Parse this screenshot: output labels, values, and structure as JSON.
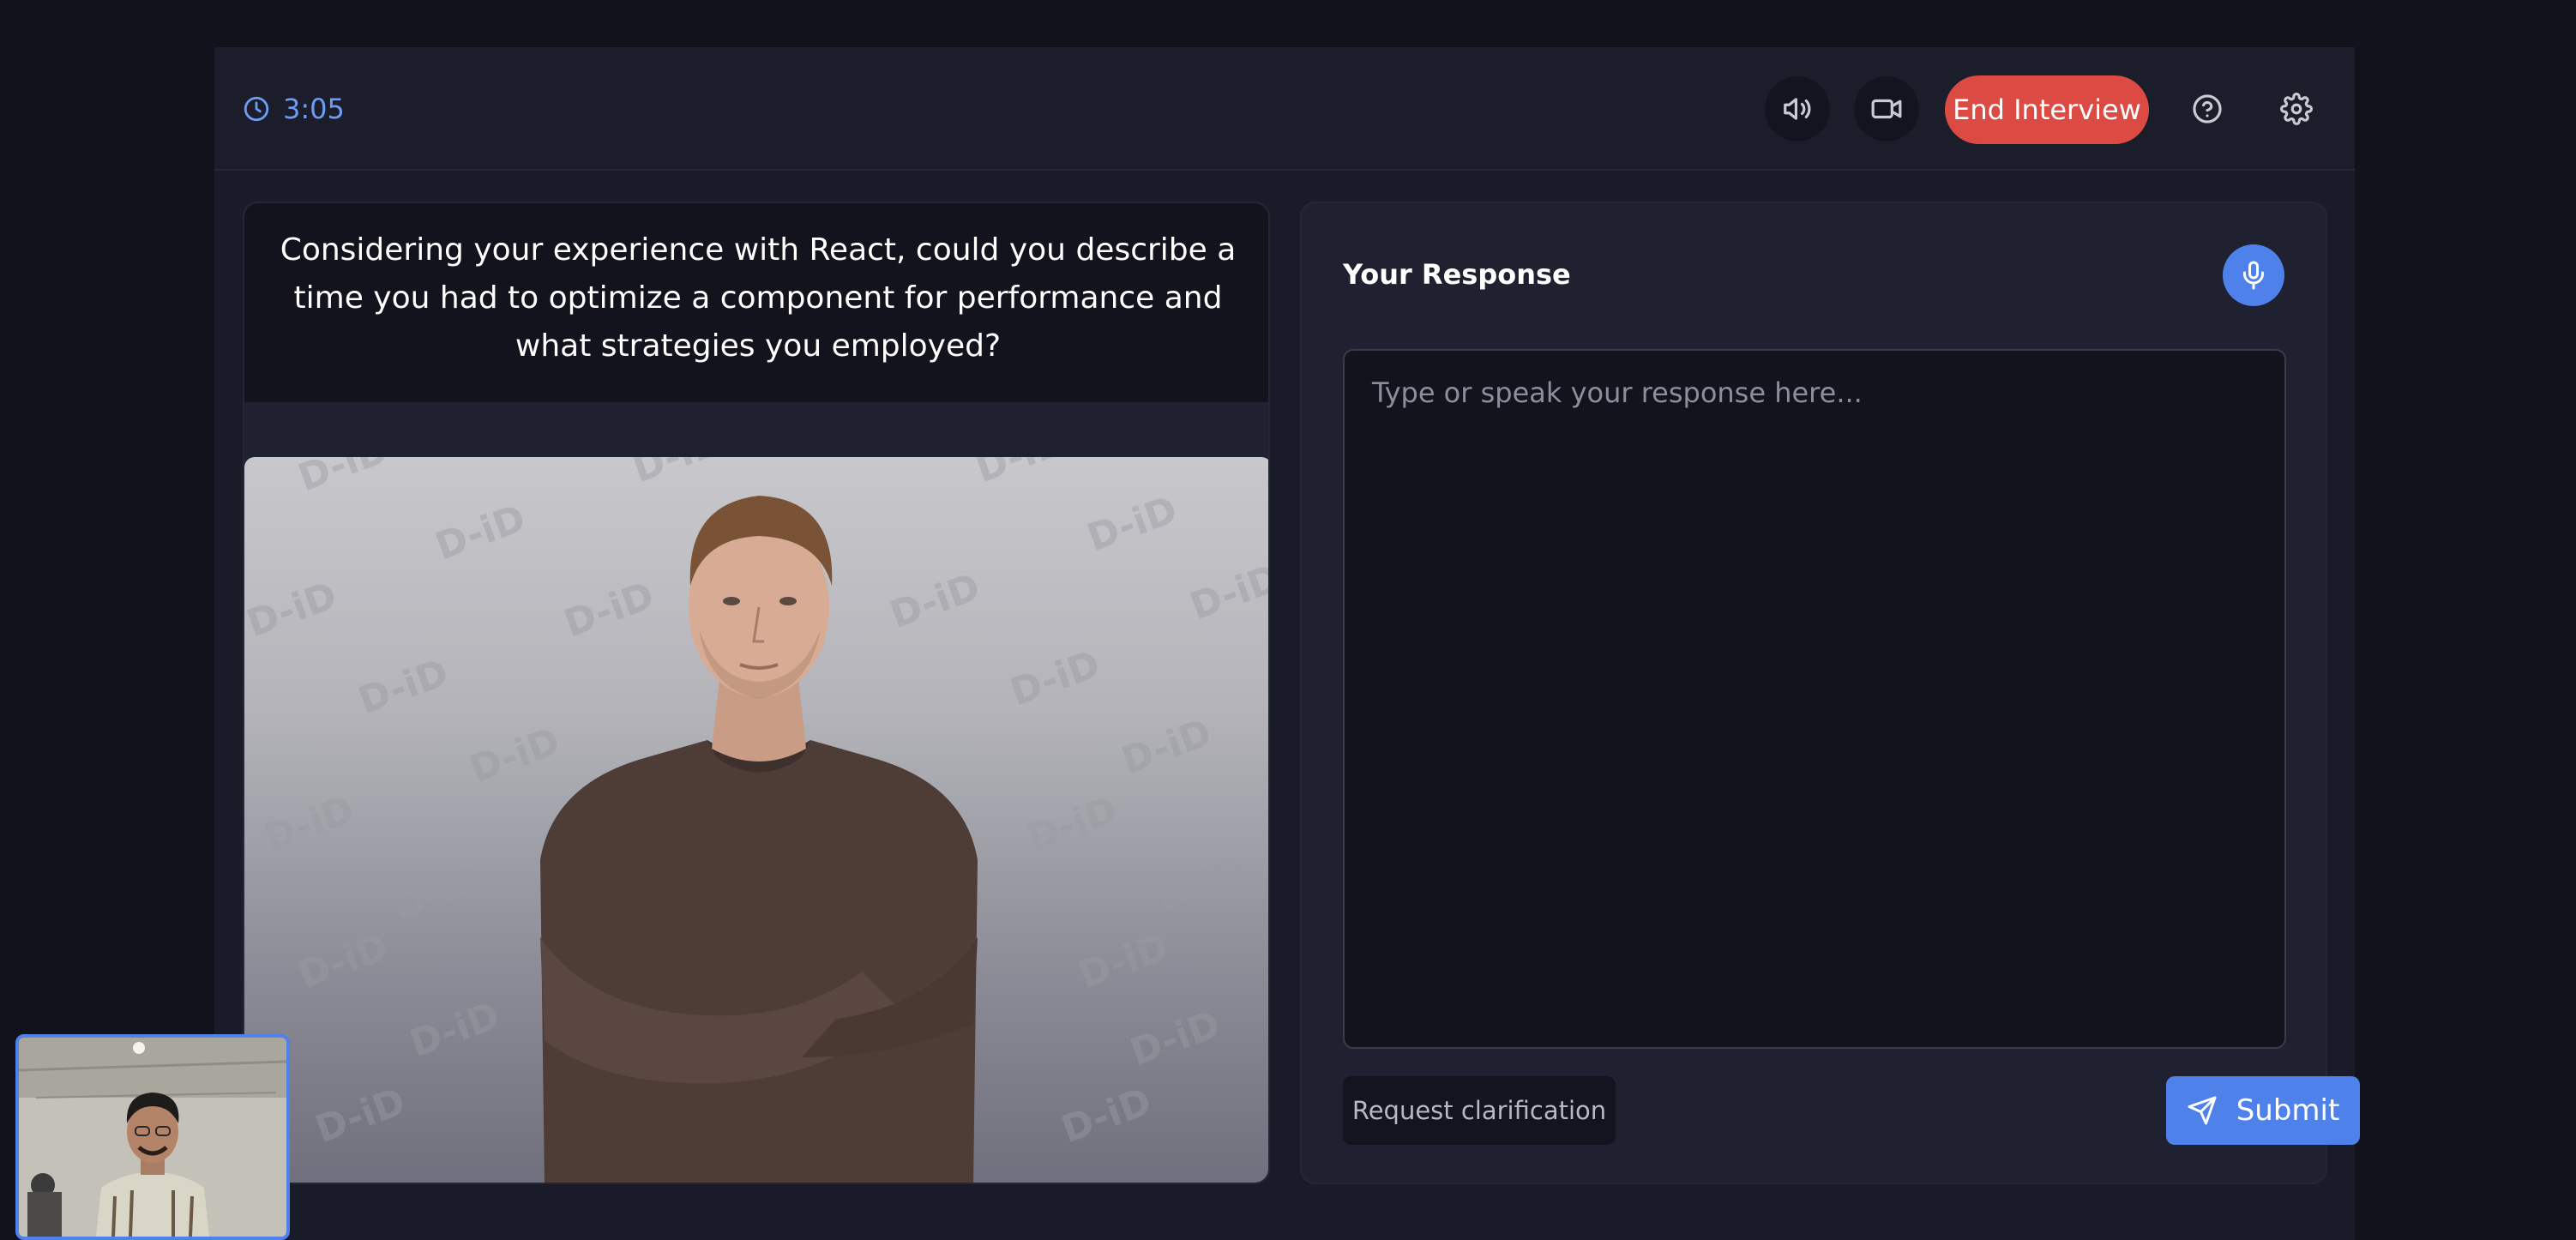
{
  "header": {
    "timer": "3:05",
    "end_interview_label": "End Interview"
  },
  "question": {
    "text": "Considering your experience with React, could you describe a time you had to optimize a component for performance and what strategies you employed?"
  },
  "avatar": {
    "watermark": "D-iD"
  },
  "response": {
    "title": "Your Response",
    "placeholder": "Type or speak your response here...",
    "value": "",
    "clarify_label": "Request clarification",
    "submit_label": "Submit"
  },
  "colors": {
    "accent": "#4e81ea",
    "danger": "#dc4b43",
    "timer": "#6f9cf3"
  },
  "icons": [
    "clock-icon",
    "volume-icon",
    "video-camera-icon",
    "help-icon",
    "gear-icon",
    "microphone-icon",
    "send-icon"
  ]
}
